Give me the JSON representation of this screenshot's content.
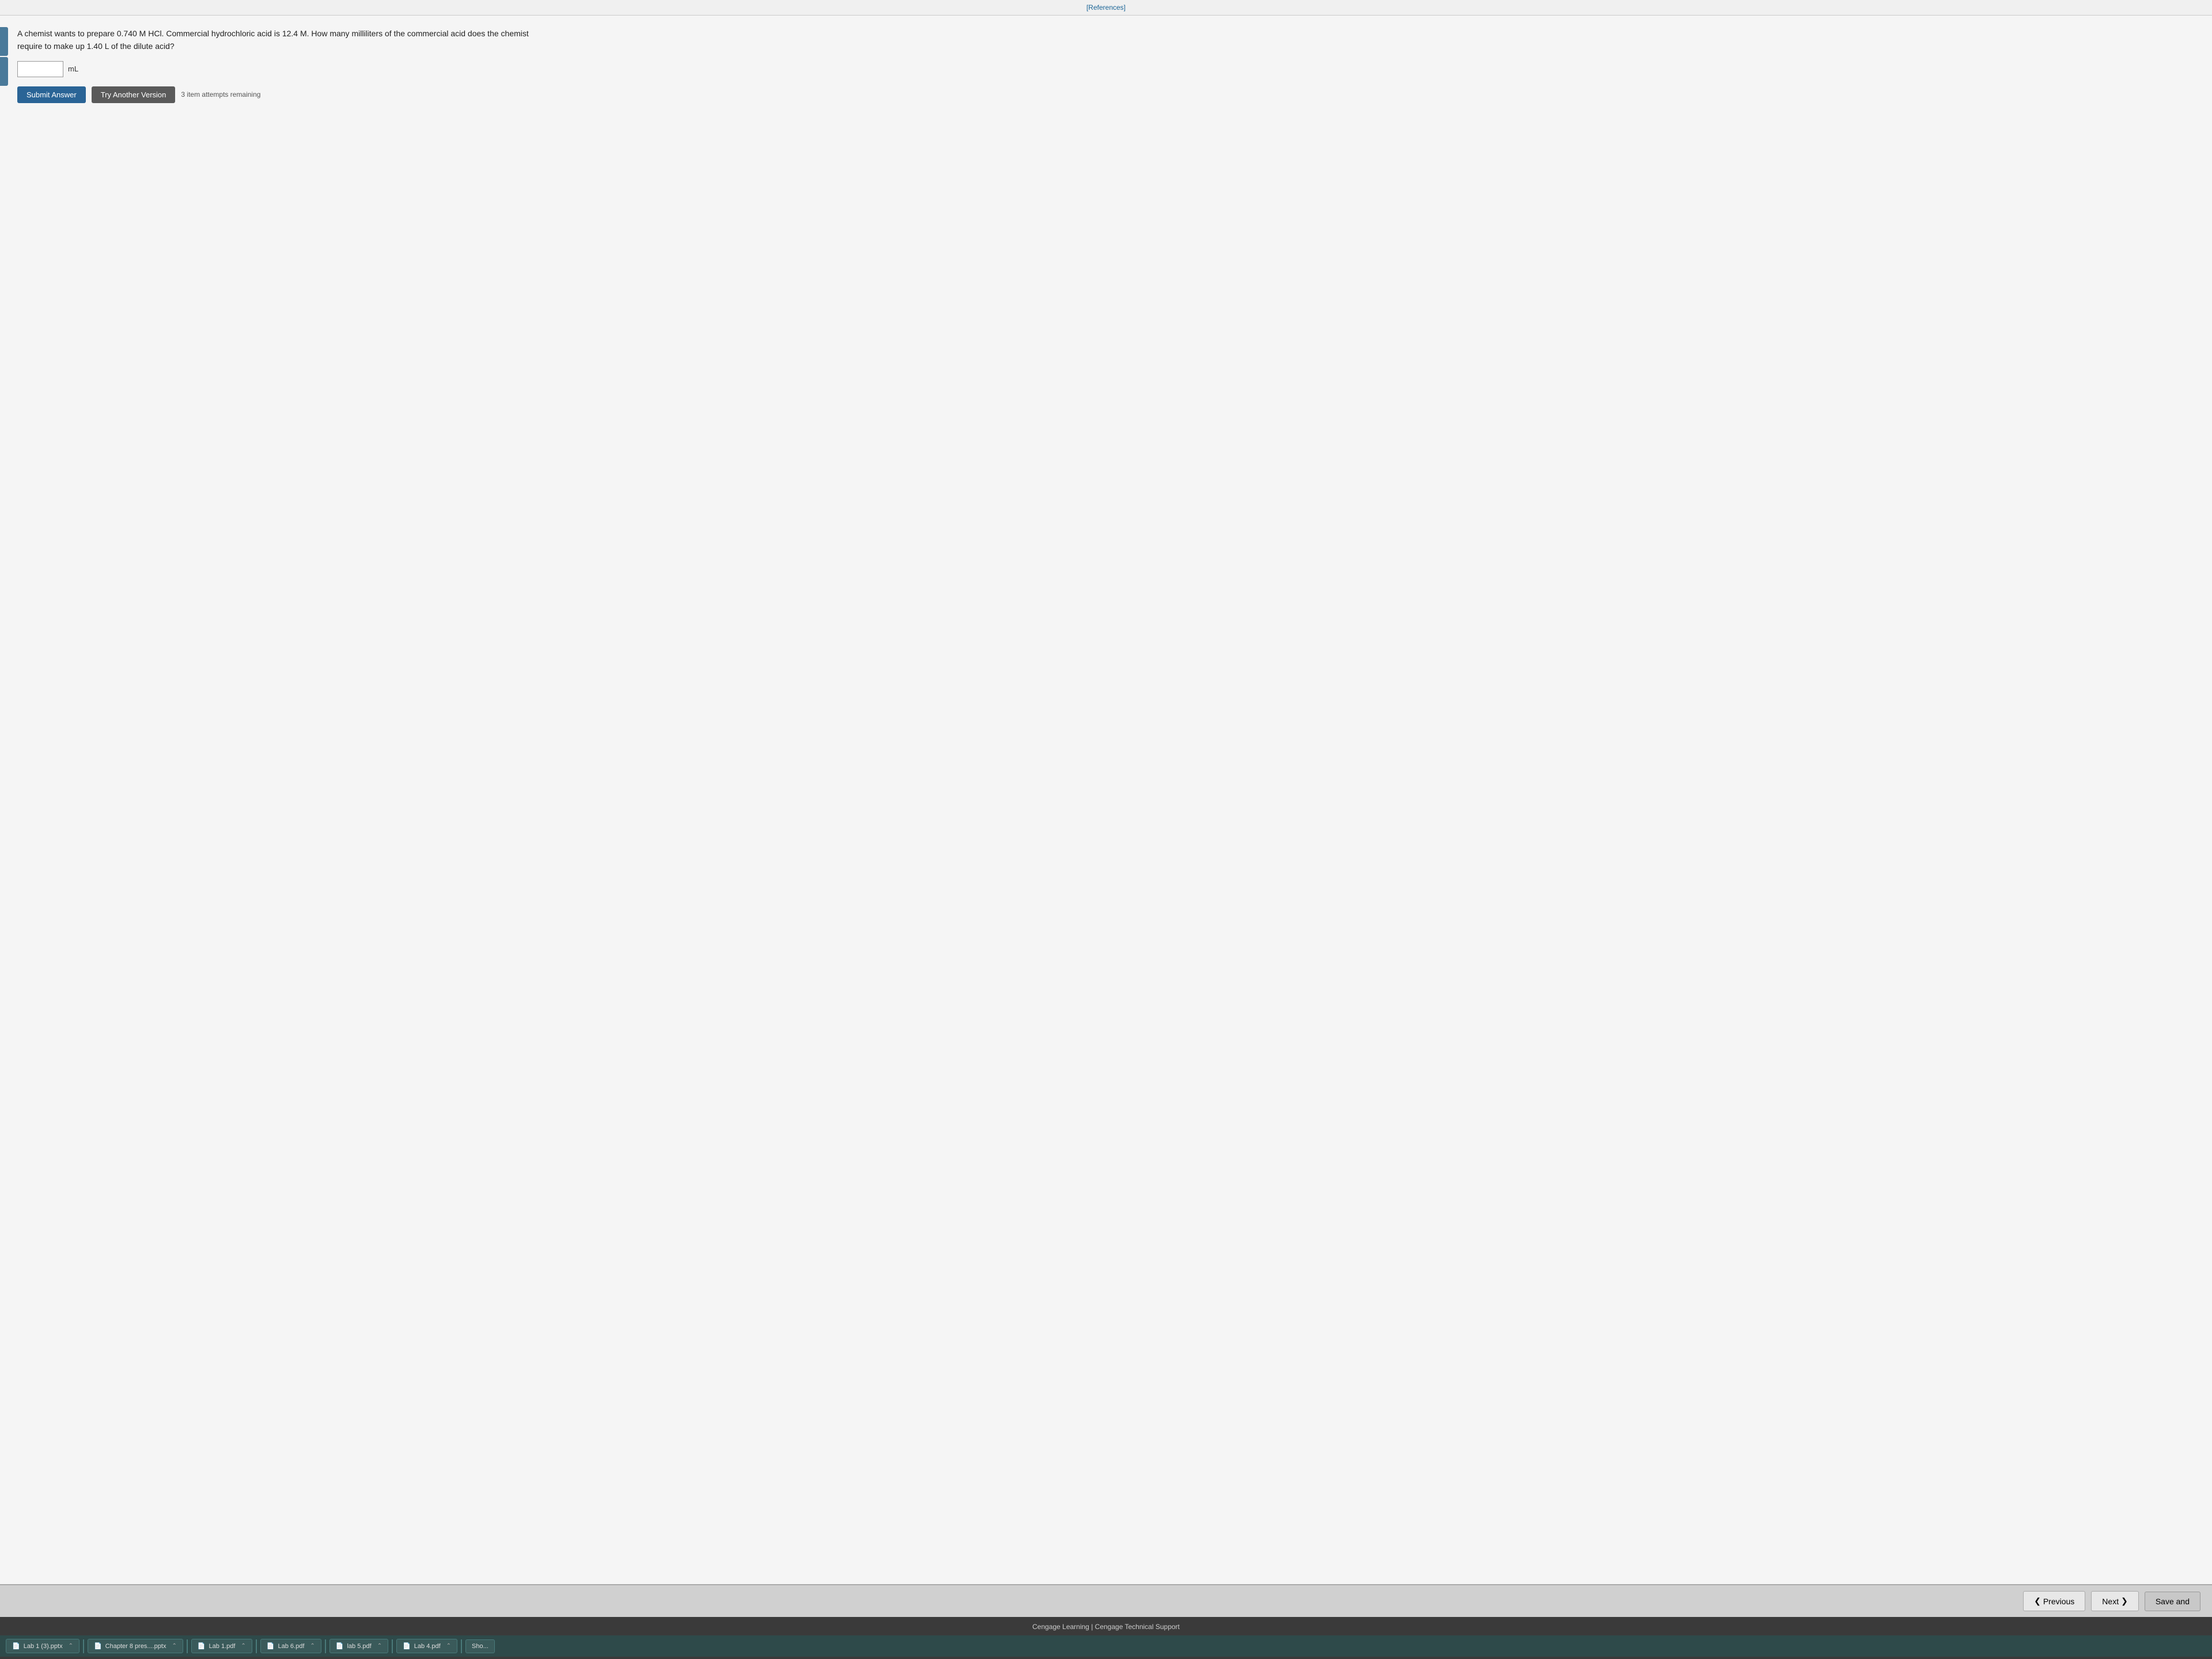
{
  "topbar": {
    "references_link": "[References]"
  },
  "question": {
    "text": "A chemist wants to prepare 0.740 M HCl. Commercial hydrochloric acid is 12.4 M. How many milliliters of the commercial acid does the chemist require to make up 1.40 L of the dilute acid?",
    "molarity_target": "0.740",
    "molarity_unit": "M",
    "compound": "HCl",
    "commercial_molarity": "12.4",
    "commercial_unit": "M",
    "volume": "1.40",
    "volume_unit": "L",
    "answer_placeholder": "",
    "answer_unit": "mL"
  },
  "buttons": {
    "submit_label": "Submit Answer",
    "try_another_label": "Try Another Version",
    "attempts_text": "3 item attempts remaining"
  },
  "navigation": {
    "previous_label": "Previous",
    "next_label": "Next",
    "save_label": "Save and"
  },
  "footer": {
    "cengage_label": "Cengage Learning",
    "separator": "|",
    "support_label": "Cengage Technical Support"
  },
  "taskbar": {
    "items": [
      {
        "label": "Lab 1 (3).pptx",
        "icon": "📄"
      },
      {
        "label": "Chapter 8 pres....pptx",
        "icon": "📄"
      },
      {
        "label": "Lab 1.pdf",
        "icon": "📄"
      },
      {
        "label": "Lab 6.pdf",
        "icon": "📄"
      },
      {
        "label": "lab 5.pdf",
        "icon": "📄"
      },
      {
        "label": "Lab 4.pdf",
        "icon": "📄"
      },
      {
        "label": "Sho...",
        "icon": ""
      }
    ]
  }
}
